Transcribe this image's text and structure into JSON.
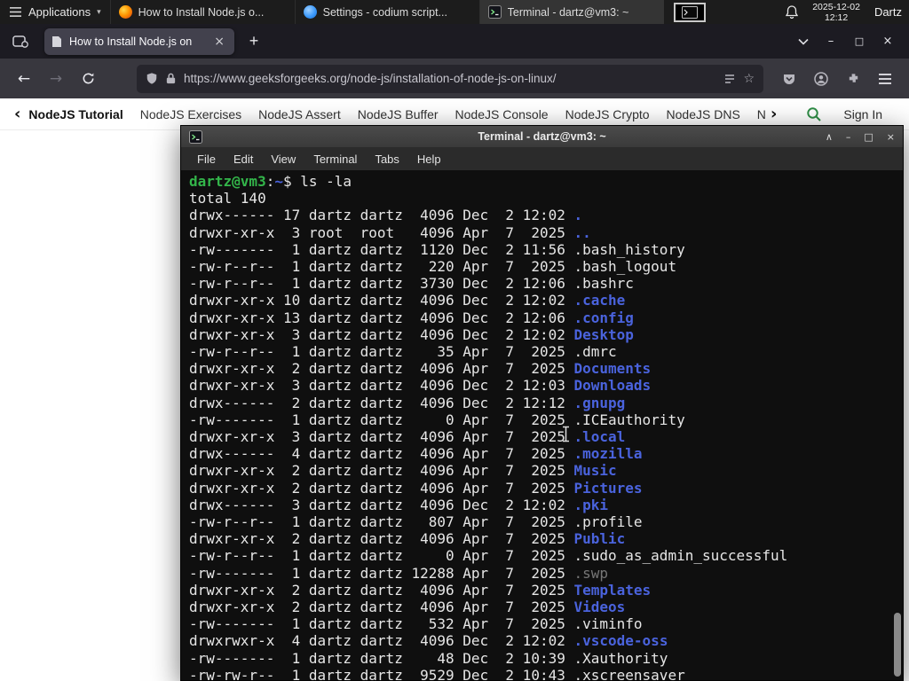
{
  "panel": {
    "applications_label": "Applications",
    "window_buttons": [
      {
        "label": "How to Install Node.js o..."
      },
      {
        "label": "Settings - codium script..."
      },
      {
        "label": "Terminal - dartz@vm3: ~"
      }
    ],
    "clock_date": "2025-12-02",
    "clock_time": "12:12",
    "user_label": "Dartz"
  },
  "browser": {
    "tab_title": "How to Install Node.js on",
    "url": "https://www.geeksforgeeks.org/node-js/installation-of-node-js-on-linux/"
  },
  "site_nav": {
    "items": [
      "NodeJS Tutorial",
      "NodeJS Exercises",
      "NodeJS Assert",
      "NodeJS Buffer",
      "NodeJS Console",
      "NodeJS Crypto",
      "NodeJS DNS",
      "Node"
    ],
    "sign_in_label": "Sign In"
  },
  "terminal": {
    "window_title": "Terminal - dartz@vm3: ~",
    "menu": [
      "File",
      "Edit",
      "View",
      "Terminal",
      "Tabs",
      "Help"
    ],
    "palette": {
      "fg": "#e6e6e6",
      "green": "#33b54a",
      "blue": "#4a63dd",
      "dim": "#767676"
    },
    "lines": [
      [
        {
          "t": "dartz@vm3",
          "c": "green",
          "b": 1
        },
        {
          "t": ":"
        },
        {
          "t": "~",
          "c": "blue",
          "b": 1
        },
        {
          "t": "$ ls -la"
        }
      ],
      [
        {
          "t": "total 140"
        }
      ],
      [
        {
          "t": "drwx------ 17 dartz dartz  4096 Dec  2 12:02 "
        },
        {
          "t": ".",
          "c": "blue",
          "b": 1
        }
      ],
      [
        {
          "t": "drwxr-xr-x  3 root  root   4096 Apr  7  2025 "
        },
        {
          "t": "..",
          "c": "blue",
          "b": 1
        }
      ],
      [
        {
          "t": "-rw-------  1 dartz dartz  1120 Dec  2 11:56 .bash_history"
        }
      ],
      [
        {
          "t": "-rw-r--r--  1 dartz dartz   220 Apr  7  2025 .bash_logout"
        }
      ],
      [
        {
          "t": "-rw-r--r--  1 dartz dartz  3730 Dec  2 12:06 .bashrc"
        }
      ],
      [
        {
          "t": "drwxr-xr-x 10 dartz dartz  4096 Dec  2 12:02 "
        },
        {
          "t": ".cache",
          "c": "blue",
          "b": 1
        }
      ],
      [
        {
          "t": "drwxr-xr-x 13 dartz dartz  4096 Dec  2 12:06 "
        },
        {
          "t": ".config",
          "c": "blue",
          "b": 1
        }
      ],
      [
        {
          "t": "drwxr-xr-x  3 dartz dartz  4096 Dec  2 12:02 "
        },
        {
          "t": "Desktop",
          "c": "blue",
          "b": 1
        }
      ],
      [
        {
          "t": "-rw-r--r--  1 dartz dartz    35 Apr  7  2025 .dmrc"
        }
      ],
      [
        {
          "t": "drwxr-xr-x  2 dartz dartz  4096 Apr  7  2025 "
        },
        {
          "t": "Documents",
          "c": "blue",
          "b": 1
        }
      ],
      [
        {
          "t": "drwxr-xr-x  3 dartz dartz  4096 Dec  2 12:03 "
        },
        {
          "t": "Downloads",
          "c": "blue",
          "b": 1
        }
      ],
      [
        {
          "t": "drwx------  2 dartz dartz  4096 Dec  2 12:12 "
        },
        {
          "t": ".gnupg",
          "c": "blue",
          "b": 1
        }
      ],
      [
        {
          "t": "-rw-------  1 dartz dartz     0 Apr  7  2025 .ICEauthority"
        }
      ],
      [
        {
          "t": "drwxr-xr-x  3 dartz dartz  4096 Apr  7  2025 "
        },
        {
          "t": ".local",
          "c": "blue",
          "b": 1
        }
      ],
      [
        {
          "t": "drwx------  4 dartz dartz  4096 Apr  7  2025 "
        },
        {
          "t": ".mozilla",
          "c": "blue",
          "b": 1
        }
      ],
      [
        {
          "t": "drwxr-xr-x  2 dartz dartz  4096 Apr  7  2025 "
        },
        {
          "t": "Music",
          "c": "blue",
          "b": 1
        }
      ],
      [
        {
          "t": "drwxr-xr-x  2 dartz dartz  4096 Apr  7  2025 "
        },
        {
          "t": "Pictures",
          "c": "blue",
          "b": 1
        }
      ],
      [
        {
          "t": "drwx------  3 dartz dartz  4096 Dec  2 12:02 "
        },
        {
          "t": ".pki",
          "c": "blue",
          "b": 1
        }
      ],
      [
        {
          "t": "-rw-r--r--  1 dartz dartz   807 Apr  7  2025 .profile"
        }
      ],
      [
        {
          "t": "drwxr-xr-x  2 dartz dartz  4096 Apr  7  2025 "
        },
        {
          "t": "Public",
          "c": "blue",
          "b": 1
        }
      ],
      [
        {
          "t": "-rw-r--r--  1 dartz dartz     0 Apr  7  2025 .sudo_as_admin_successful"
        }
      ],
      [
        {
          "t": "-rw-------  1 dartz dartz 12288 Apr  7  2025 "
        },
        {
          "t": ".swp",
          "c": "dim"
        }
      ],
      [
        {
          "t": "drwxr-xr-x  2 dartz dartz  4096 Apr  7  2025 "
        },
        {
          "t": "Templates",
          "c": "blue",
          "b": 1
        }
      ],
      [
        {
          "t": "drwxr-xr-x  2 dartz dartz  4096 Apr  7  2025 "
        },
        {
          "t": "Videos",
          "c": "blue",
          "b": 1
        }
      ],
      [
        {
          "t": "-rw-------  1 dartz dartz   532 Apr  7  2025 .viminfo"
        }
      ],
      [
        {
          "t": "drwxrwxr-x  4 dartz dartz  4096 Dec  2 12:02 "
        },
        {
          "t": ".vscode-oss",
          "c": "blue",
          "b": 1
        }
      ],
      [
        {
          "t": "-rw-------  1 dartz dartz    48 Dec  2 10:39 .Xauthority"
        }
      ],
      [
        {
          "t": "-rw-rw-r--  1 dartz dartz  9529 Dec  2 10:43 .xscreensaver"
        }
      ]
    ]
  },
  "icons": {
    "new_tab": "+",
    "tab_close": "×",
    "window_close": "×",
    "window_minimize": "–",
    "window_maximize": "□",
    "window_shade": "∧",
    "back_arrow": "←",
    "forward_arrow": "→",
    "chevron_left": "‹",
    "chevron_right": "›",
    "caret_down": "▾",
    "star": "☆"
  },
  "colors": {
    "accent_green": "#2f8d46"
  }
}
